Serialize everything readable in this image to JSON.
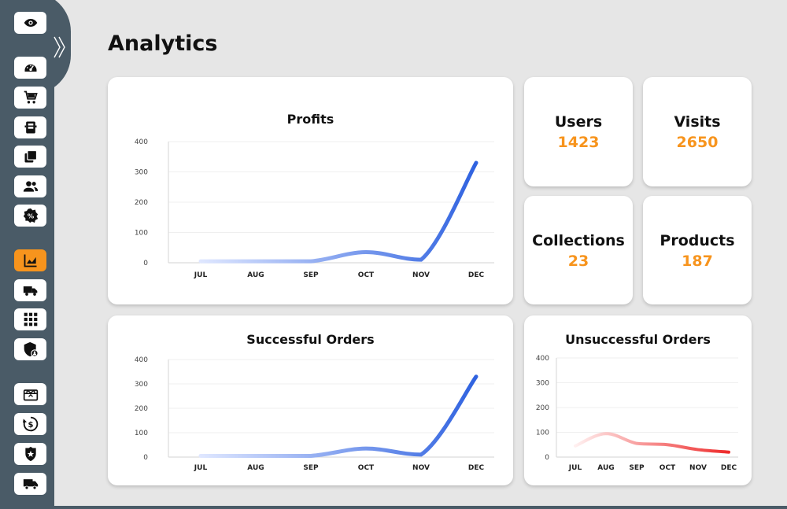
{
  "page": {
    "title": "Analytics"
  },
  "sidebar": {
    "items": [
      {
        "icon": "eye-icon"
      },
      {
        "icon": "dashboard-gauge-icon"
      },
      {
        "icon": "shopping-cart-icon"
      },
      {
        "icon": "archive-box-icon"
      },
      {
        "icon": "collections-icon"
      },
      {
        "icon": "users-icon"
      },
      {
        "icon": "discount-badge-icon"
      },
      {
        "icon": "analytics-chart-icon",
        "active": true
      },
      {
        "icon": "delivery-truck-icon"
      },
      {
        "icon": "apps-grid-icon"
      },
      {
        "icon": "admin-shield-icon"
      },
      {
        "icon": "gift-card-icon"
      },
      {
        "icon": "refund-dollar-icon"
      },
      {
        "icon": "police-badge-icon"
      },
      {
        "icon": "shipping-truck-icon"
      }
    ],
    "colors": {
      "background": "#4a5b67",
      "active": "#f7941d"
    }
  },
  "stats": {
    "users": {
      "label": "Users",
      "value": "1423"
    },
    "visits": {
      "label": "Visits",
      "value": "2650"
    },
    "collections": {
      "label": "Collections",
      "value": "23"
    },
    "products": {
      "label": "Products",
      "value": "187"
    }
  },
  "chart_data": [
    {
      "id": "profits",
      "type": "line",
      "title": "Profits",
      "categories": [
        "JUL",
        "AUG",
        "SEP",
        "OCT",
        "NOV",
        "DEC"
      ],
      "yticks": [
        "0",
        "100",
        "200",
        "300",
        "400"
      ],
      "ylim": [
        0,
        400
      ],
      "series": [
        {
          "values": [
            5,
            5,
            5,
            35,
            10,
            330
          ]
        }
      ],
      "colors": [
        "#dfe7ff",
        "#2f62e0"
      ],
      "grid": true
    },
    {
      "id": "successful",
      "type": "line",
      "title": "Successful Orders",
      "categories": [
        "JUL",
        "AUG",
        "SEP",
        "OCT",
        "NOV",
        "DEC"
      ],
      "yticks": [
        "0",
        "100",
        "200",
        "300",
        "400"
      ],
      "ylim": [
        0,
        400
      ],
      "series": [
        {
          "values": [
            5,
            5,
            5,
            35,
            10,
            330
          ]
        }
      ],
      "colors": [
        "#dfe7ff",
        "#2f62e0"
      ],
      "grid": true
    },
    {
      "id": "unsuccessful",
      "type": "line",
      "title": "Unsuccessful Orders",
      "categories": [
        "JUL",
        "AUG",
        "SEP",
        "OCT",
        "NOV",
        "DEC"
      ],
      "yticks": [
        "0",
        "100",
        "200",
        "300",
        "400"
      ],
      "ylim": [
        0,
        400
      ],
      "series": [
        {
          "values": [
            45,
            95,
            55,
            50,
            30,
            20
          ]
        }
      ],
      "colors": [
        "#fff0f0",
        "#ee2a2a"
      ],
      "grid": true
    }
  ]
}
